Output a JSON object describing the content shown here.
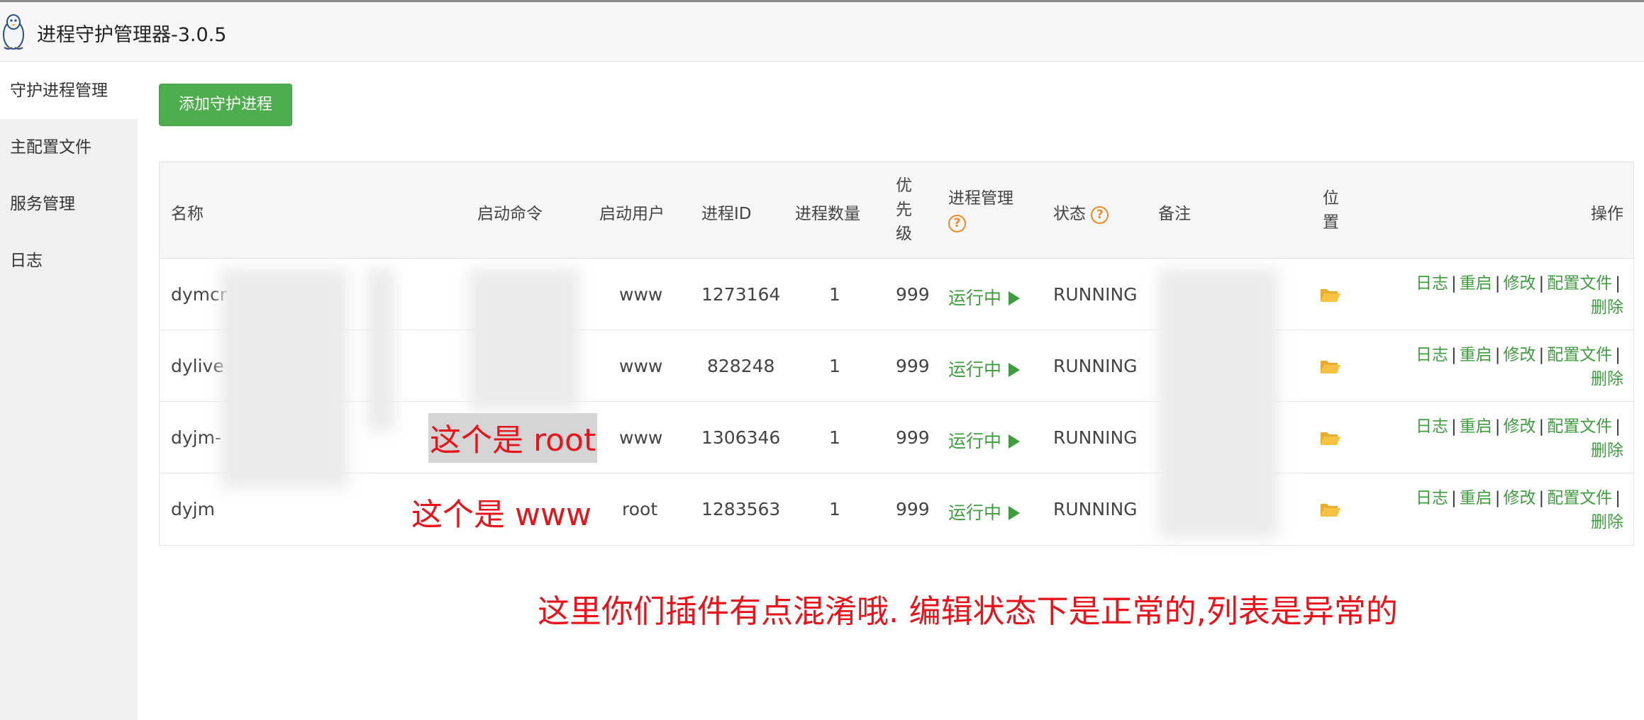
{
  "app": {
    "title": "进程守护管理器-3.0.5"
  },
  "sidebar": {
    "items": [
      {
        "label": "守护进程管理",
        "active": true
      },
      {
        "label": "主配置文件",
        "active": false
      },
      {
        "label": "服务管理",
        "active": false
      },
      {
        "label": "日志",
        "active": false
      }
    ]
  },
  "toolbar": {
    "add_label": "添加守护进程"
  },
  "table": {
    "headers": {
      "name": "名称",
      "command": "启动命令",
      "user": "启动用户",
      "pid": "进程ID",
      "count": "进程数量",
      "priority": [
        "优",
        "先",
        "级"
      ],
      "proc_mgmt": "进程管理",
      "status": "状态",
      "note": "备注",
      "location": [
        "位",
        "置"
      ],
      "actions": "操作"
    },
    "rows": [
      {
        "name": "dymcr",
        "user": "www",
        "pid": "1273164",
        "count": "1",
        "priority": "999",
        "proc_state": "运行中",
        "status": "RUNNING"
      },
      {
        "name": "dylive",
        "user": "www",
        "pid": "828248",
        "count": "1",
        "priority": "999",
        "proc_state": "运行中",
        "status": "RUNNING"
      },
      {
        "name": "dyjm-",
        "user": "www",
        "pid": "1306346",
        "count": "1",
        "priority": "999",
        "proc_state": "运行中",
        "status": "RUNNING"
      },
      {
        "name": "dyjm",
        "user": "root",
        "pid": "1283563",
        "count": "1",
        "priority": "999",
        "proc_state": "运行中",
        "status": "RUNNING"
      }
    ],
    "actions": {
      "log": "日志",
      "restart": "重启",
      "edit": "修改",
      "config": "配置文件",
      "delete": "删除",
      "separator": "|"
    }
  },
  "annotations": {
    "row3": "这个是 root",
    "row4": "这个是 www",
    "note": "这里你们插件有点混淆哦. 编辑状态下是正常的,列表是异常的"
  },
  "colors": {
    "accent_green": "#4cae4c",
    "link_green": "#3f9d3f",
    "annotation_red": "#e8141c",
    "help_orange": "#f08a24",
    "folder_yellow": "#f5c242"
  }
}
